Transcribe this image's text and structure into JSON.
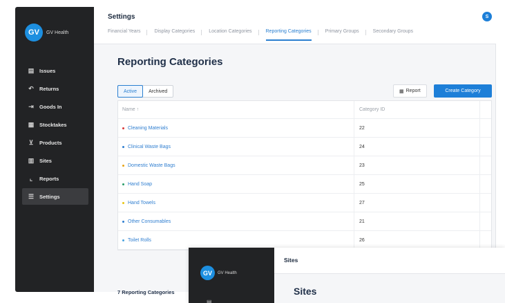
{
  "app": {
    "logo_initials": "GV",
    "logo_text": "GV Health"
  },
  "sidebar": {
    "items": [
      {
        "label": "Issues",
        "icon": "inbox-icon",
        "glyph": "▤"
      },
      {
        "label": "Returns",
        "icon": "return-icon",
        "glyph": "↶"
      },
      {
        "label": "Goods In",
        "icon": "goods-in-icon",
        "glyph": "⇥"
      },
      {
        "label": "Stocktakes",
        "icon": "stocktake-icon",
        "glyph": "▦"
      },
      {
        "label": "Products",
        "icon": "cart-icon",
        "glyph": "⊻"
      },
      {
        "label": "Sites",
        "icon": "building-icon",
        "glyph": "▥"
      },
      {
        "label": "Reports",
        "icon": "chart-icon",
        "glyph": "⌞"
      },
      {
        "label": "Settings",
        "icon": "settings-list-icon",
        "glyph": "☰",
        "active": true
      }
    ]
  },
  "header": {
    "title": "Settings",
    "avatar_initial": "S",
    "tabs": [
      {
        "label": "Financial Years"
      },
      {
        "label": "Display Categories"
      },
      {
        "label": "Location Categories"
      },
      {
        "label": "Reporting Categories",
        "active": true
      },
      {
        "label": "Primary Groups"
      },
      {
        "label": "Secondary Groups"
      }
    ]
  },
  "page": {
    "title": "Reporting Categories",
    "filter": {
      "active": "Active",
      "archived": "Archived"
    },
    "report_button": "Report",
    "report_icon": "▦",
    "create_button": "Create Category",
    "table": {
      "columns": {
        "name": "Name ↑",
        "id": "Category ID"
      },
      "rows": [
        {
          "name": "Cleaning Materials",
          "id": "22",
          "color": "#d93a3a"
        },
        {
          "name": "Clinical Waste Bags",
          "id": "24",
          "color": "#2f7ed0"
        },
        {
          "name": "Domestic Waste Bags",
          "id": "23",
          "color": "#e7a317"
        },
        {
          "name": "Hand Soap",
          "id": "25",
          "color": "#2a9d6a"
        },
        {
          "name": "Hand Towels",
          "id": "27",
          "color": "#e8c514"
        },
        {
          "name": "Other Consumables",
          "id": "21",
          "color": "#2f7ed0"
        },
        {
          "name": "Toilet Rolls",
          "id": "26",
          "color": "#4aa3df"
        }
      ]
    },
    "footer_count": "7 Reporting Categories"
  },
  "second_window": {
    "logo_initials": "GV",
    "logo_text": "GV Health",
    "top_title": "Sites",
    "page_title": "Sites"
  }
}
